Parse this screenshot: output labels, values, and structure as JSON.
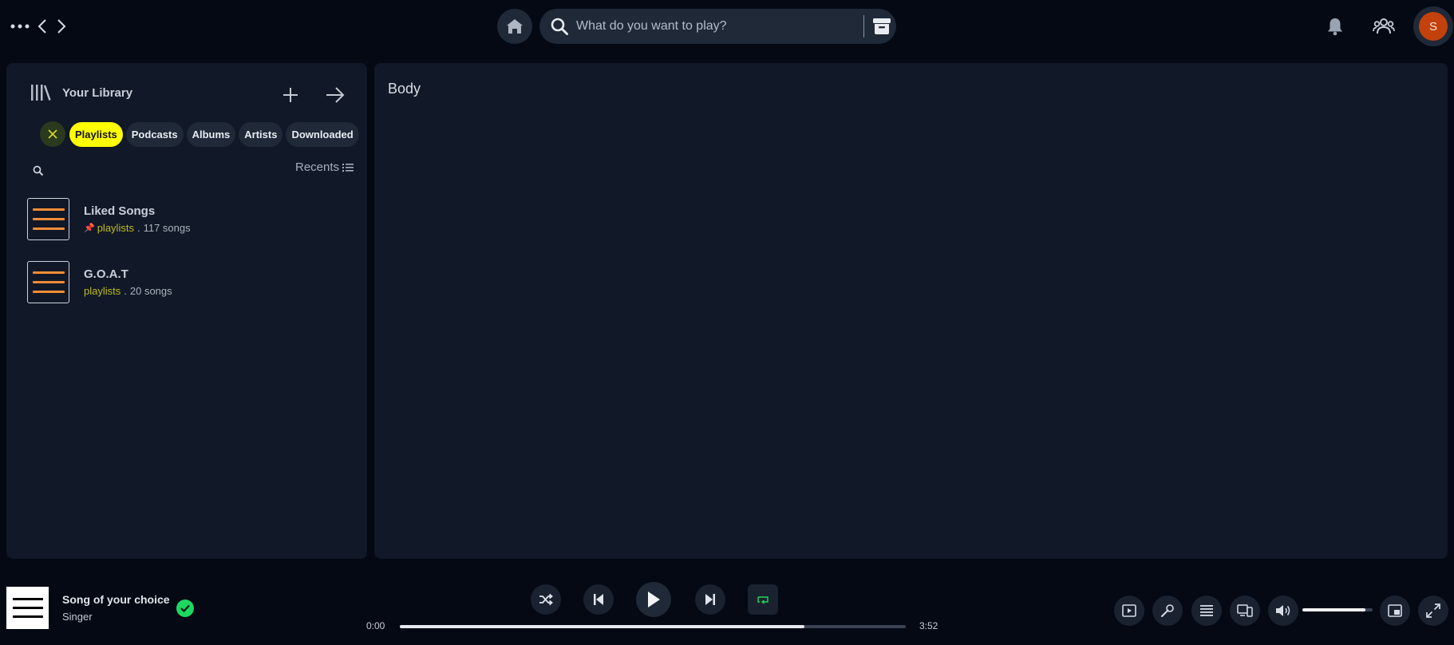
{
  "topbar": {
    "search_placeholder": "What do you want to play?",
    "avatar_initial": "S"
  },
  "library": {
    "title": "Your Library",
    "filters": [
      "Playlists",
      "Podcasts",
      "Albums",
      "Artists",
      "Downloaded"
    ],
    "active_filter": "Playlists",
    "sort_label": "Recents",
    "items": [
      {
        "name": "Liked Songs",
        "type": "playlists",
        "separator": ".",
        "count": "117 songs",
        "pinned": true
      },
      {
        "name": "G.O.A.T",
        "type": "playlists",
        "separator": ".",
        "count": "20 songs",
        "pinned": false
      }
    ]
  },
  "main": {
    "title": "Body"
  },
  "player": {
    "track_title": "Song of your choice",
    "artist": "Singer",
    "current_time": "0:00",
    "duration": "3:52",
    "progress_fraction": 0.8,
    "volume_fraction": 0.9
  },
  "colors": {
    "background": "#040914",
    "panel": "#111827",
    "accent_yellow": "#ffff00",
    "accent_green": "#1ed760",
    "thumb_orange": "#f28c38",
    "avatar": "#c2410c"
  },
  "icons": {
    "topbar": [
      "more-dots-icon",
      "chevron-left-icon",
      "chevron-right-icon",
      "home-icon",
      "search-icon",
      "browse-icon",
      "bell-icon",
      "friends-icon"
    ],
    "library": [
      "library-icon",
      "plus-icon",
      "arrow-right-icon",
      "close-icon",
      "search-icon",
      "list-icon",
      "pin-icon"
    ],
    "player": [
      "check-icon",
      "shuffle-icon",
      "previous-icon",
      "play-icon",
      "next-icon",
      "repeat-icon",
      "now-playing-view-icon",
      "lyrics-icon",
      "queue-icon",
      "connect-device-icon",
      "volume-icon",
      "mini-player-icon",
      "fullscreen-icon"
    ]
  }
}
